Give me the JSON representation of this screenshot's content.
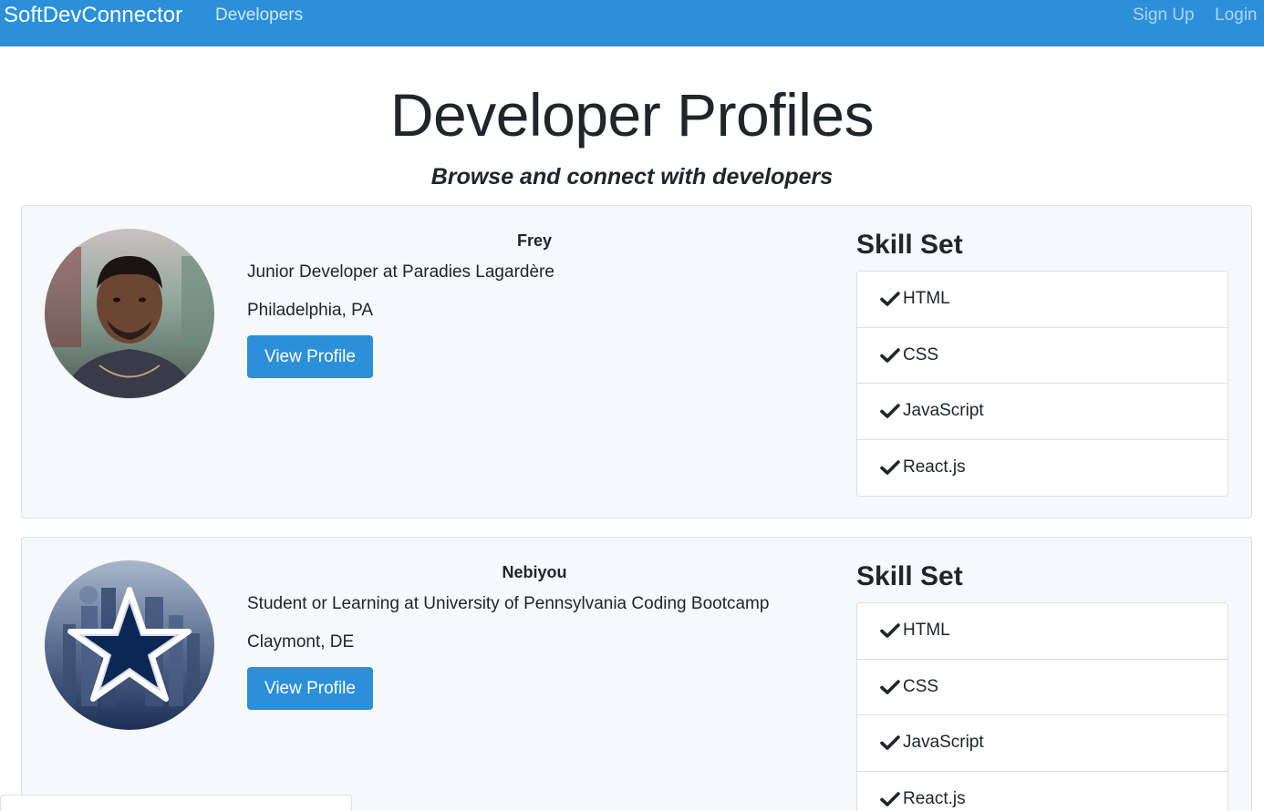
{
  "navbar": {
    "brand": "SoftDevConnector",
    "developers_link": "Developers",
    "signup_link": "Sign Up",
    "login_link": "Login",
    "color": "#2b90d9"
  },
  "page": {
    "title": "Developer Profiles",
    "subtitle": "Browse and connect with developers"
  },
  "profiles": [
    {
      "name": "Frey",
      "status": "Junior Developer at Paradies Lagardère",
      "location": "Philadelphia, PA",
      "view_label": "View Profile",
      "avatar_icon": "user-photo",
      "skill_title": "Skill Set",
      "skills": [
        "HTML",
        "CSS",
        "JavaScript",
        "React.js"
      ]
    },
    {
      "name": "Nebiyou",
      "status": "Student or Learning at University of Pennsylvania Coding Bootcamp",
      "location": "Claymont, DE",
      "view_label": "View Profile",
      "avatar_icon": "star-logo-photo",
      "skill_title": "Skill Set",
      "skills": [
        "HTML",
        "CSS",
        "JavaScript",
        "React.js"
      ]
    }
  ]
}
